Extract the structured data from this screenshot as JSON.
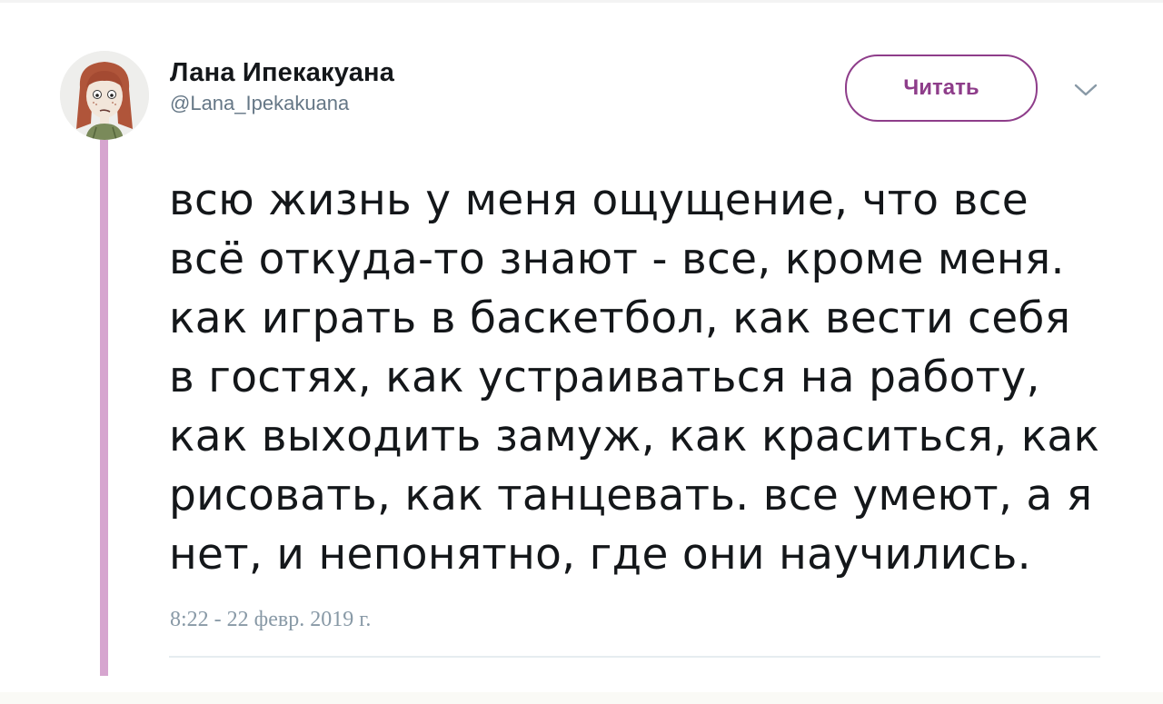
{
  "user": {
    "display_name": "Лана Ипекакуана",
    "username": "@Lana_Ipekakuana",
    "avatar_icon": "drawn-girl-portrait-avatar"
  },
  "actions": {
    "follow_label": "Читать",
    "menu_icon": "chevron-down-icon"
  },
  "tweet": {
    "text": "всю жизнь у меня ощущение, что все\nвсё откуда-то знают - все, кроме меня.\nкак играть в баскетбол, как вести себя\nв гостях, как устраиваться на работу,\nкак выходить замуж, как краситься, как\nрисовать, как танцевать. все умеют, а я\nнет, и непонятно, где они научились.",
    "timestamp": "8:22 - 22 февр. 2019 г."
  },
  "colors": {
    "accent": "#8e3d8a",
    "thread_line": "#d6a5cf",
    "secondary_text": "#657786",
    "timestamp_text": "#8899a6",
    "divider": "#e6ecf0"
  }
}
